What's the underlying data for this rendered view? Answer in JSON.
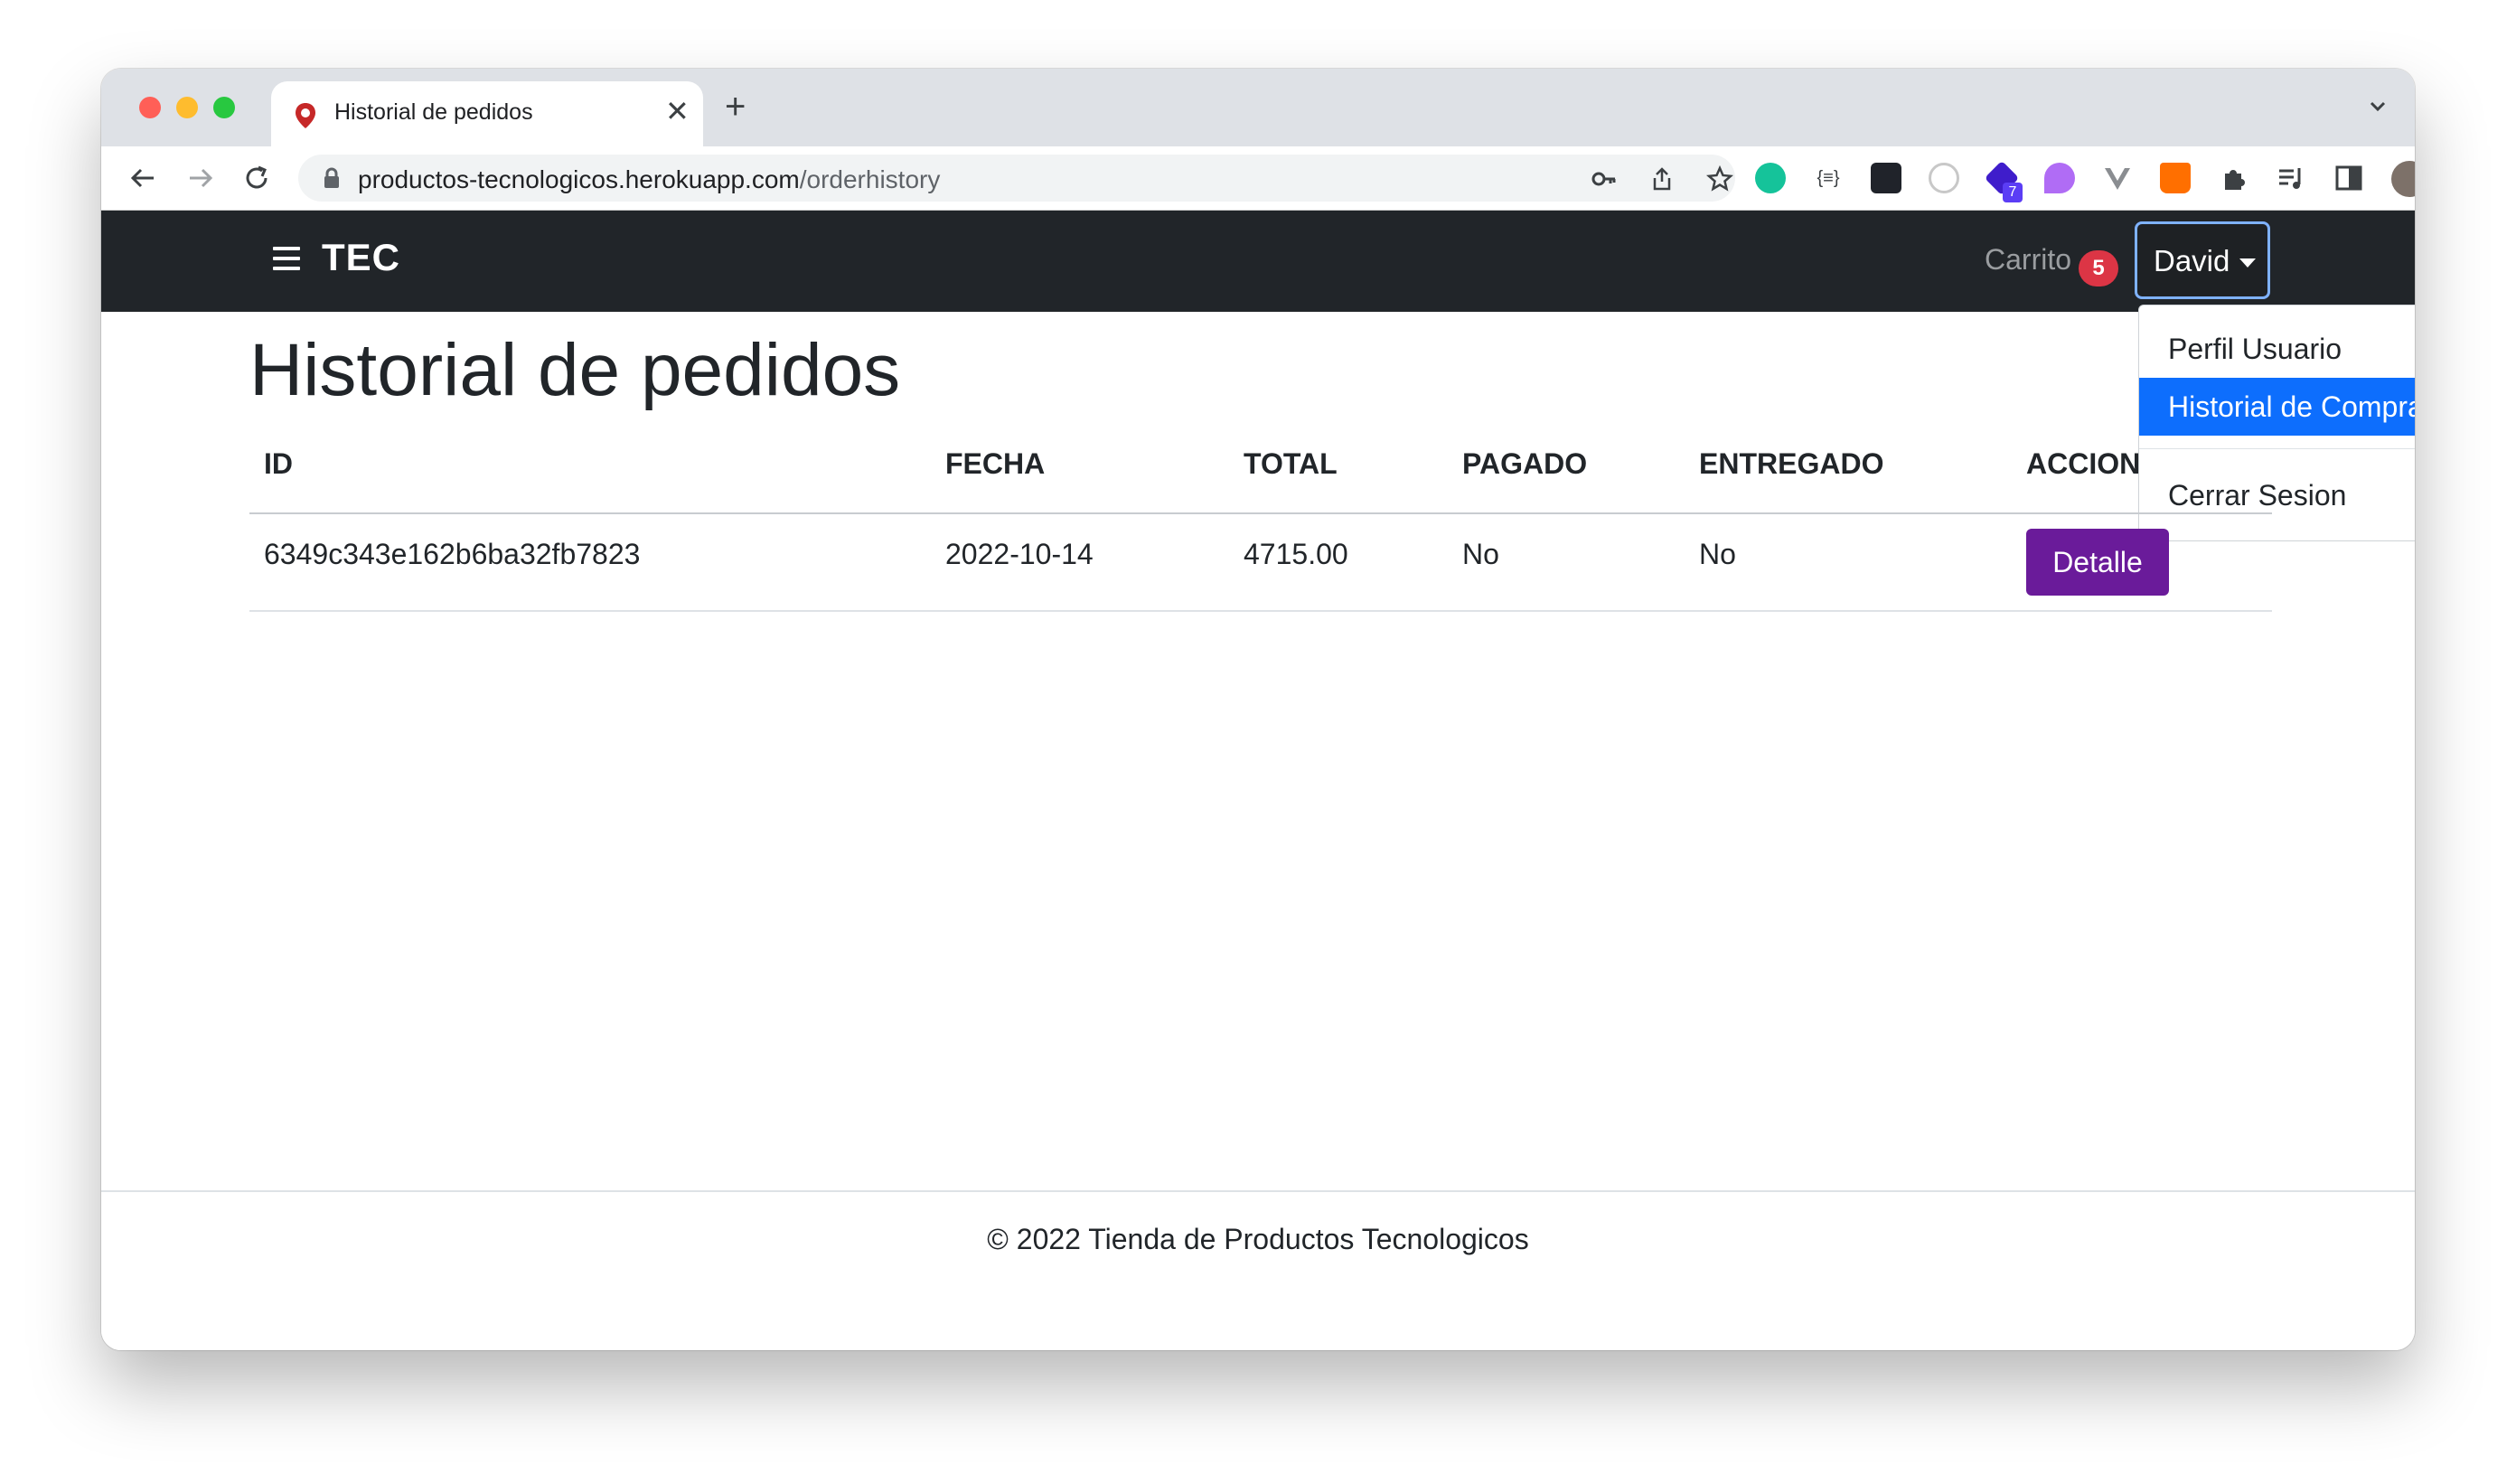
{
  "browser": {
    "tab_title": "Historial de pedidos",
    "url_host": "productos-tecnologicos.herokuapp.com",
    "url_path": "/orderhistory",
    "extension_badge": "7"
  },
  "navbar": {
    "brand": "TEC",
    "cart_label": "Carrito",
    "cart_count": "5",
    "user_name": "David"
  },
  "user_menu": {
    "items": [
      "Perfil Usuario",
      "Historial de Compras",
      "Cerrar Sesion"
    ],
    "active_index": 1
  },
  "main": {
    "title": "Historial de pedidos",
    "table": {
      "columns": [
        "ID",
        "FECHA",
        "TOTAL",
        "PAGADO",
        "ENTREGADO",
        "ACCION"
      ],
      "rows": [
        {
          "id": "6349c343e162b6ba32fb7823",
          "date": "2022-10-14",
          "total": "4715.00",
          "paid": "No",
          "delivered": "No",
          "action": "Detalle"
        }
      ]
    }
  },
  "footer": {
    "text": "© 2022 Tienda de Productos Tecnologicos"
  },
  "colors": {
    "navbar": "#212529",
    "badge": "#dc3545",
    "active_menu": "#0d6efd",
    "detail_button": "#6a1b9a"
  }
}
